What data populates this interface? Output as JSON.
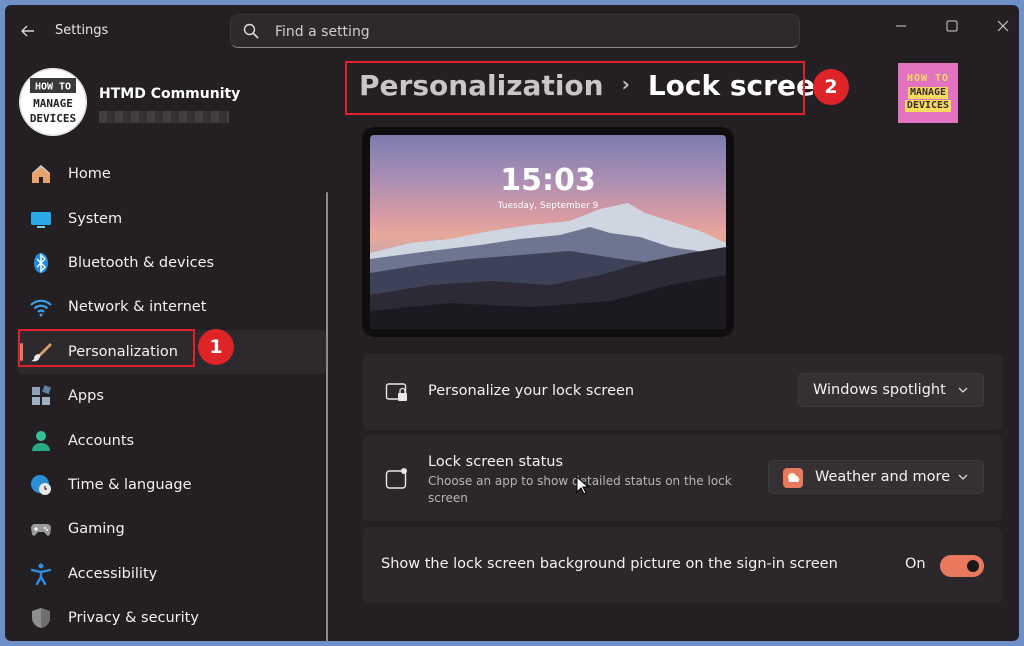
{
  "titlebar": {
    "app_title": "Settings",
    "back_icon": "back-arrow-icon",
    "search_placeholder": "Find a setting",
    "search_icon": "search-icon",
    "controls": [
      "minimize-icon",
      "maximize-icon",
      "close-icon"
    ]
  },
  "profile": {
    "name": "HTMD Community",
    "avatar_text": [
      "HOW TO",
      "MANAGE",
      "DEVICES"
    ]
  },
  "sidebar": {
    "items": [
      {
        "label": "Home",
        "icon": "home-icon"
      },
      {
        "label": "System",
        "icon": "system-icon"
      },
      {
        "label": "Bluetooth & devices",
        "icon": "bluetooth-icon"
      },
      {
        "label": "Network & internet",
        "icon": "wifi-icon"
      },
      {
        "label": "Personalization",
        "icon": "brush-icon",
        "active": true
      },
      {
        "label": "Apps",
        "icon": "apps-icon"
      },
      {
        "label": "Accounts",
        "icon": "accounts-icon"
      },
      {
        "label": "Time & language",
        "icon": "globe-clock-icon"
      },
      {
        "label": "Gaming",
        "icon": "gamepad-icon"
      },
      {
        "label": "Accessibility",
        "icon": "accessibility-icon"
      },
      {
        "label": "Privacy & security",
        "icon": "shield-icon"
      }
    ]
  },
  "header": {
    "parent": "Personalization",
    "separator": "›",
    "current": "Lock screen"
  },
  "annotations": {
    "badge1": "1",
    "badge2": "2"
  },
  "logo_text": [
    "HOW TO",
    "MANAGE",
    "DEVICES"
  ],
  "preview": {
    "time": "15:03",
    "date": "Tuesday, September 9"
  },
  "settings": {
    "personalize": {
      "title": "Personalize your lock screen",
      "icon": "lock-screen-icon",
      "value": "Windows spotlight"
    },
    "status": {
      "title": "Lock screen status",
      "subtitle": "Choose an app to show detailed status on the lock screen",
      "icon": "status-icon",
      "value": "Weather and more",
      "value_icon": "weather-icon"
    },
    "signin": {
      "title": "Show the lock screen background picture on the sign-in screen",
      "state_label": "On",
      "on": true
    }
  },
  "colors": {
    "accent": "#e9785d",
    "annotation_red": "#e0202a",
    "window_bg": "#241f22",
    "card_bg": "#2c272a"
  }
}
